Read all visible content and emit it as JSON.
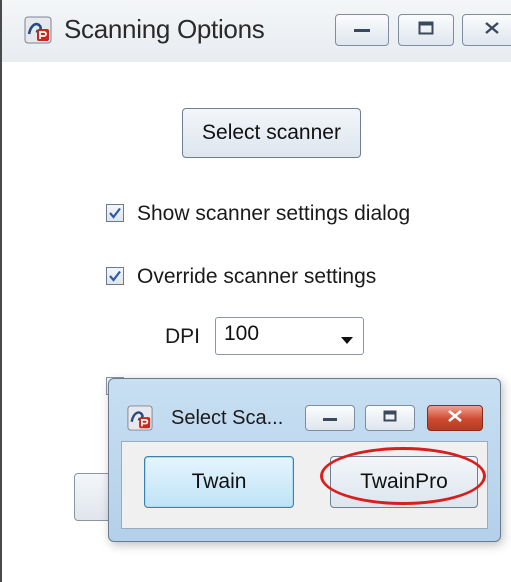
{
  "main_window": {
    "title": "Scanning Options",
    "app_icon": "twain-app-icon",
    "controls": {
      "minimize_icon": "minimize-icon",
      "maximize_icon": "maximize-icon",
      "close_icon": "close-icon"
    },
    "select_scanner_label": "Select scanner",
    "show_dialog": {
      "label": "Show scanner settings dialog",
      "checked": true
    },
    "override_settings": {
      "label": "Override scanner settings",
      "checked": true
    },
    "dpi": {
      "label": "DPI",
      "value": "100"
    }
  },
  "dialog": {
    "title": "Select Sca...",
    "app_icon": "twain-app-icon",
    "twain_label": "Twain",
    "twainpro_label": "TwainPro"
  },
  "annotation": {
    "highlight_color": "#d81f1f"
  }
}
